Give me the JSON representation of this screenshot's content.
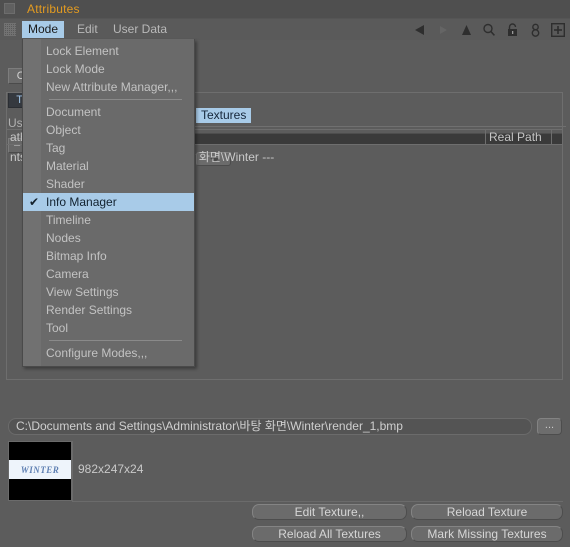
{
  "window": {
    "title": "Attributes",
    "grip_icon": "window-grip-icon"
  },
  "menubar": {
    "grip_icon": "menu-grip-icon",
    "items": [
      {
        "label": "Mode",
        "active": true
      },
      {
        "label": "Edit",
        "active": false
      },
      {
        "label": "User Data",
        "active": false
      }
    ],
    "icons": [
      {
        "name": "back-arrow-icon",
        "enabled": true
      },
      {
        "name": "forward-arrow-icon",
        "enabled": false
      },
      {
        "name": "up-arrow-icon",
        "enabled": true
      },
      {
        "name": "search-icon",
        "enabled": true
      },
      {
        "name": "lock-icon",
        "enabled": true
      },
      {
        "name": "person-icon",
        "enabled": true
      },
      {
        "name": "add-box-icon",
        "enabled": true
      }
    ]
  },
  "mode_menu": {
    "items": [
      {
        "label": "Lock Element",
        "checked": false,
        "separator_after": false
      },
      {
        "label": "Lock Mode",
        "checked": false,
        "separator_after": false
      },
      {
        "label": "New Attribute Manager,,,",
        "checked": false,
        "separator_after": true
      },
      {
        "label": "Document",
        "checked": false,
        "separator_after": false
      },
      {
        "label": "Object",
        "checked": false,
        "separator_after": false
      },
      {
        "label": "Tag",
        "checked": false,
        "separator_after": false
      },
      {
        "label": "Material",
        "checked": false,
        "separator_after": false
      },
      {
        "label": "Shader",
        "checked": false,
        "separator_after": false
      },
      {
        "label": "Info Manager",
        "checked": true,
        "separator_after": false
      },
      {
        "label": "Timeline",
        "checked": false,
        "separator_after": false
      },
      {
        "label": "Nodes",
        "checked": false,
        "separator_after": false
      },
      {
        "label": "Bitmap Info",
        "checked": false,
        "separator_after": false
      },
      {
        "label": "Camera",
        "checked": false,
        "separator_after": false
      },
      {
        "label": "View Settings",
        "checked": false,
        "separator_after": false
      },
      {
        "label": "Render Settings",
        "checked": false,
        "separator_after": false
      },
      {
        "label": "Tool",
        "checked": false,
        "separator_after": true
      },
      {
        "label": "Configure Modes,,,",
        "checked": false,
        "separator_after": false
      }
    ],
    "check_glyph": "✔"
  },
  "panel": {
    "object_button": "O",
    "tag_button": "Te",
    "use_label": "Us",
    "minus_button": "–",
    "tab_label": "Textures",
    "dropdown_arrow_icon": "chevron-down-icon",
    "columns": [
      {
        "label": "ath"
      },
      {
        "label": "Real Path"
      },
      {
        "label": ""
      }
    ],
    "rows": [
      {
        "path": "nts and Settings\\Administrator\\바탕 화면\\Winter ---"
      }
    ]
  },
  "path_bar": {
    "value": "C:\\Documents and Settings\\Administrator\\바탕 화면\\Winter\\render_1,bmp",
    "browse_label": "...",
    "browse_icon": "ellipsis-icon"
  },
  "preview": {
    "watermark": "WINTER",
    "dimensions": "982x247x24"
  },
  "buttons": {
    "edit_texture": "Edit Texture,,",
    "reload_texture": "Reload Texture",
    "reload_all_textures": "Reload All Textures",
    "mark_missing_textures": "Mark Missing Textures"
  },
  "colors": {
    "app_bg": "#5c5c5c",
    "title_text": "#e39b21",
    "highlight": "#a8cbe8",
    "menu_bg": "#6a6a6a",
    "field_dark": "#3a3a3a"
  }
}
